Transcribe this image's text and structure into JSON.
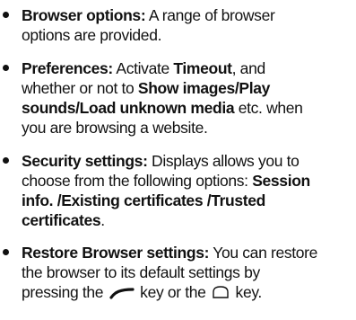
{
  "items": [
    {
      "title": "Browser options:",
      "line1": " A range of browser",
      "line2": "options are provided."
    },
    {
      "title": "Preferences:",
      "line1a": " Activate ",
      "timeout": "Timeout",
      "line1b": ", and",
      "line2a": "whether or not to ",
      "show": "Show images/Play",
      "line3": "sounds/Load unknown media",
      "line3b": " etc. when",
      "line4": "you are browsing a website."
    },
    {
      "title": "Security settings:",
      "line1": " Displays allows you to",
      "line2a": "choose from the following options: ",
      "session": "Session",
      "line3": "info. /Existing certificates /Trusted",
      "line4": "certificates",
      "line4b": "."
    },
    {
      "title": "Restore Browser settings:",
      "line1": " You can restore",
      "line2": "the browser to its default settings by",
      "line3a": "pressing the ",
      "line3b": " key or the ",
      "line3c": " key."
    }
  ],
  "icons": {
    "left_soft_key": "left-soft-key-icon",
    "menu_key": "menu-key-icon"
  }
}
